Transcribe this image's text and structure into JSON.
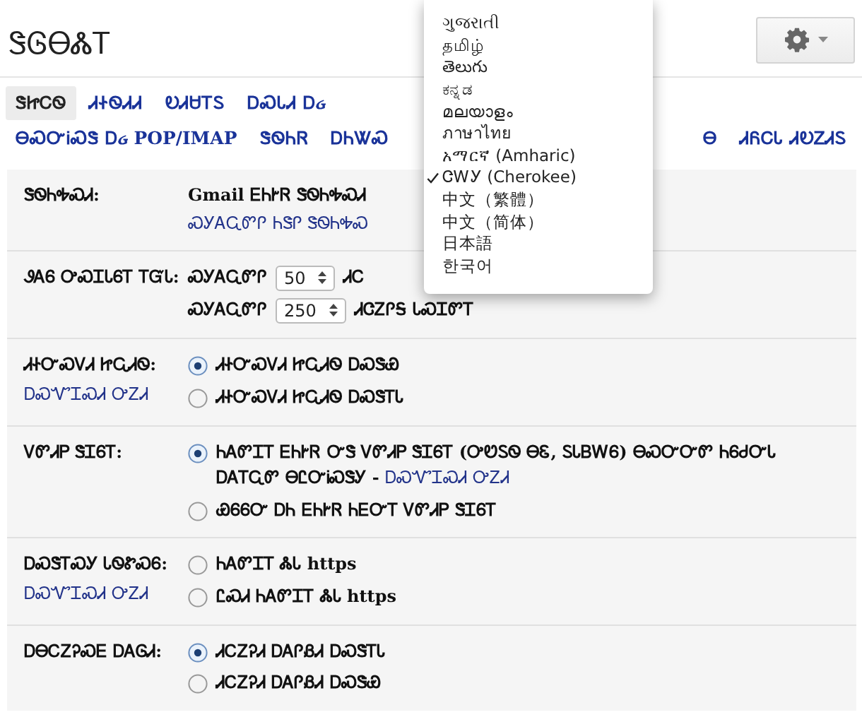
{
  "window": {
    "title": "ᏕᎶᎾᏜᎢ"
  },
  "tab_rows": [
    {
      "tabs": [
        {
          "label": "ᏕᏥᏟᏫ",
          "selected": true
        },
        {
          "label": "ᏗᏐᏫᏗᏗ",
          "selected": false
        },
        {
          "label": "ᎧᏗᏌᎢᏚ",
          "selected": false
        },
        {
          "label": "ᎠᏍᏓᏗ Ꭰᏽ",
          "selected": false
        }
      ],
      "tabs_after_menu": []
    },
    {
      "tabs": [
        {
          "label": "ᎾᏍᏅᎥᏍᏕ Ꭰᏽ POP/IMAP",
          "selected": false
        },
        {
          "label": "ᏕᏫᏂᏒ",
          "selected": false
        },
        {
          "label": "ᎠᏂᏔᏍ",
          "selected": false
        }
      ],
      "tabs_after_menu": [
        {
          "label": "Ꮎ",
          "selected": false
        },
        {
          "label": "ᏗᏲᏟᏓ ᏗᎧᏃᏗᏚ",
          "selected": false
        }
      ]
    }
  ],
  "settings": [
    {
      "label": "ᏕᏫᏂᎭᏍᏗ:",
      "kind": "info",
      "value": "Gmail ᎬᏂᎨᏒ ᏕᏫᏂᎭᏍᏗ",
      "value_link": "ᏍᎩᎪᏩᏛᎵ ᏂᏕᎵ ᏕᏫᏂᎭᏍ"
    },
    {
      "label": "ᏭᎪᏮ ᎤᏍᏆᏓᏮᎢ ᎢᏳᏓ:",
      "kind": "select",
      "options": [
        {
          "before": "ᏍᎩᎪᏩᏛᎵ",
          "value": "50",
          "after": "ᏗᏟ"
        },
        {
          "before": "ᏍᎩᎪᏩᏛᎵ",
          "value": "250",
          "after": "ᏗᏣᏃᎵᎦ ᏓᏍᏆᏛᎢ"
        }
      ]
    },
    {
      "label": "ᏗᏐᏅᏍᏙᏗ ᏥᏩᏗᏫ:",
      "link": "ᎠᏍᏉᏆᏍᏗ ᎤᏃᏗ",
      "kind": "radio",
      "options": [
        {
          "text": "ᏗᏐᏅᏍᏙᏗ ᏥᏩᏗᏫ ᎠᏍᏕᏯ",
          "selected": true
        },
        {
          "text": "ᏗᏐᏅᏍᏙᏗ ᏥᏩᏗᏫ ᎠᏍᏕᎢᏓ",
          "selected": false
        }
      ]
    },
    {
      "label": "ᏙᏛᏗᏢ ᏕᏆᏮᎢ:",
      "kind": "radio",
      "options": [
        {
          "text": "ᏂᎪᏛᏆᎢ ᎬᏂᎨᏒ ᏅᏕ ᏙᏛᏗᏢ ᏕᏆᏮᎢ (ᎤᏬᏚᏫ ᎾᏋ, ᏚᏓᏴᎳᏮ) ᎾᏍᏅᏅᏛ ᏂᏮᏧᏅᏓ ᎠᎪᎢᏩᏛ ᎾᏝᏅᎥᏍᏕᎩ -",
          "link": "ᎠᏍᏉᏆᏍᏗ ᎤᏃᏗ",
          "selected": true
        },
        {
          "text": "ᏯᏮᏮᏅ ᎠᏂ ᎬᏂᎨᏒ ᏂᎬᏅᎢ ᏙᏛᏗᏢ ᏕᏆᏮᎢ",
          "selected": false
        }
      ]
    },
    {
      "label": "ᎠᏍᏕᎢᏍᎩ ᏓᏫᏑᏍᏮ:",
      "link": "ᎠᏍᏉᏆᏍᏗ ᎤᏃᏗ",
      "kind": "radio",
      "options": [
        {
          "text": "ᏂᎪᏛᏆᎢ ᏜᏓ https",
          "selected": false
        },
        {
          "text": "ᏝᏍᏗ ᏂᎪᏛᏆᎢ ᏜᏓ https",
          "selected": false
        }
      ]
    },
    {
      "label": "ᎠᎾᏟᏃᎮᏍᎬ ᎠᎪᎶᏗ:",
      "kind": "radio",
      "options": [
        {
          "text": "ᏗᏟᏃᎮᏗ ᎠᎪᎵᏰᏗ ᎠᏍᏕᎢᏓ",
          "selected": true
        },
        {
          "text": "ᏗᏟᏃᎮᏗ ᎠᎪᎵᏰᏗ ᎠᏍᏕᏯ",
          "selected": false
        }
      ]
    }
  ],
  "language_menu": {
    "items": [
      {
        "label": "ગુજરાતી",
        "selected": false
      },
      {
        "label": "தமிழ்",
        "selected": false
      },
      {
        "label": "తెలుగు",
        "selected": false
      },
      {
        "label": "ಕನ್ನಡ",
        "selected": false
      },
      {
        "label": "മലയാളം",
        "selected": false
      },
      {
        "label": "ภาษาไทย",
        "selected": false
      },
      {
        "label": "አማርኛ (Amharic)",
        "selected": false
      },
      {
        "label": "ᏣᎳᎩ (Cherokee)",
        "selected": true
      },
      {
        "label": "中文（繁體）",
        "selected": false
      },
      {
        "label": "中文（简体）",
        "selected": false
      },
      {
        "label": "日本語",
        "selected": false
      },
      {
        "label": "한국어",
        "selected": false
      }
    ]
  }
}
